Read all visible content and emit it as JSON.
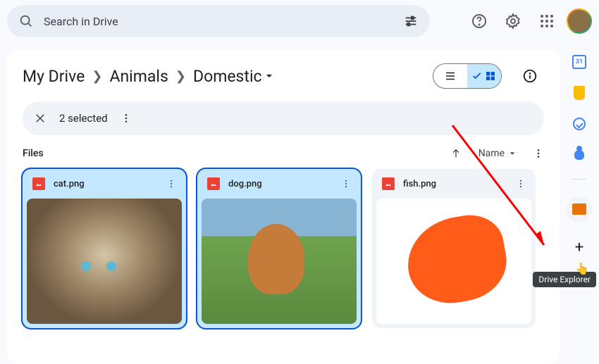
{
  "search": {
    "placeholder": "Search in Drive"
  },
  "breadcrumb": {
    "root": "My Drive",
    "folder1": "Animals",
    "current": "Domestic"
  },
  "selection": {
    "text": "2 selected"
  },
  "files": {
    "label": "Files",
    "sort": "Name",
    "items": [
      {
        "name": "cat.png",
        "selected": true
      },
      {
        "name": "dog.png",
        "selected": true
      },
      {
        "name": "fish.png",
        "selected": false
      }
    ]
  },
  "sidepanel": {
    "calendar_day": "31",
    "tooltip": "Drive Explorer"
  }
}
